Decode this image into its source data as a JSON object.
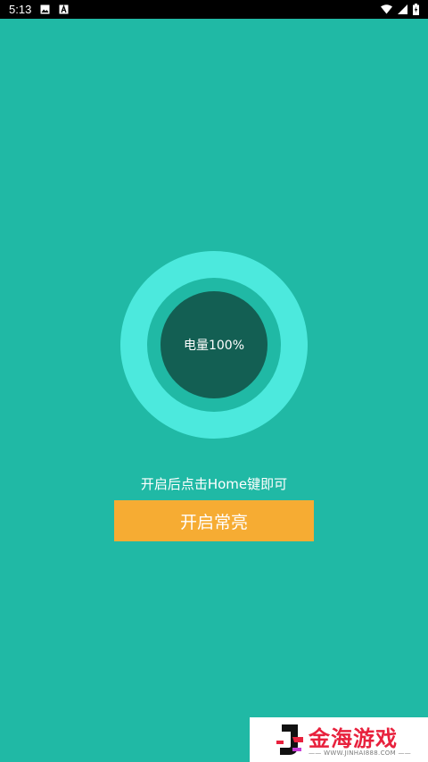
{
  "status_bar": {
    "time": "5:13",
    "icons_left": [
      "image-icon",
      "a-badge-icon"
    ],
    "icons_right": [
      "wifi-icon",
      "signal-icon",
      "battery-charging-icon"
    ]
  },
  "colors": {
    "background": "#20b9a5",
    "ring_outer": "#4ce9dd",
    "ring_inner": "#135f53",
    "button": "#f6ac33",
    "watermark_text": "#e8213d"
  },
  "battery_ring": {
    "label": "电量100%",
    "level_percent": 100
  },
  "hint": "开启后点击Home键即可",
  "action_button": {
    "label": "开启常亮"
  },
  "watermark": {
    "title": "金海游戏",
    "url": "—— WWW.JINHAI888.COM ——"
  }
}
